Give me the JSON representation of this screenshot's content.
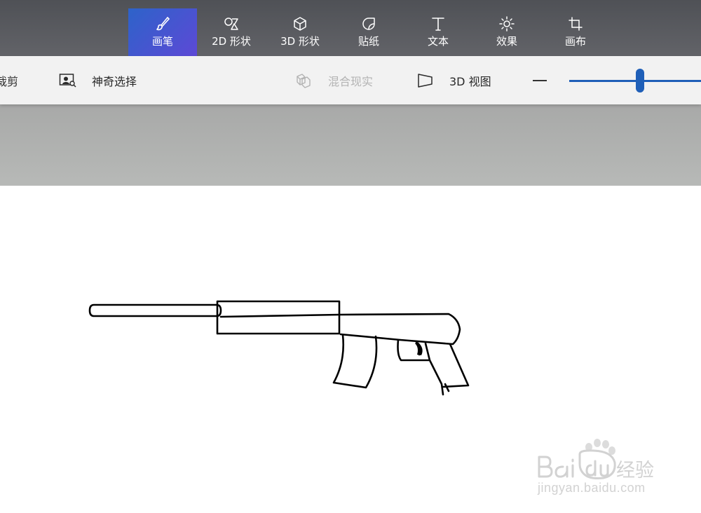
{
  "ribbon": {
    "tabs": [
      {
        "label": "画笔",
        "icon": "brush-icon",
        "active": true
      },
      {
        "label": "2D 形状",
        "icon": "shapes-2d-icon"
      },
      {
        "label": "3D 形状",
        "icon": "cube-icon"
      },
      {
        "label": "贴纸",
        "icon": "sticker-icon"
      },
      {
        "label": "文本",
        "icon": "text-icon"
      },
      {
        "label": "效果",
        "icon": "sun-icon"
      },
      {
        "label": "画布",
        "icon": "canvas-crop-icon"
      }
    ]
  },
  "toolbar": {
    "crop_label": "裁剪",
    "magic_select_label": "神奇选择",
    "mixed_reality_label": "混合现实",
    "view_3d_label": "3D 视图"
  },
  "colors": {
    "ribbon_bg": "#58595e",
    "active_tab": "#3f56d0",
    "slider": "#1f5fb8",
    "workspace": "#b0b2b0"
  },
  "watermark": {
    "brand": "Baidu经验",
    "url": "jingyan.baidu.com"
  }
}
